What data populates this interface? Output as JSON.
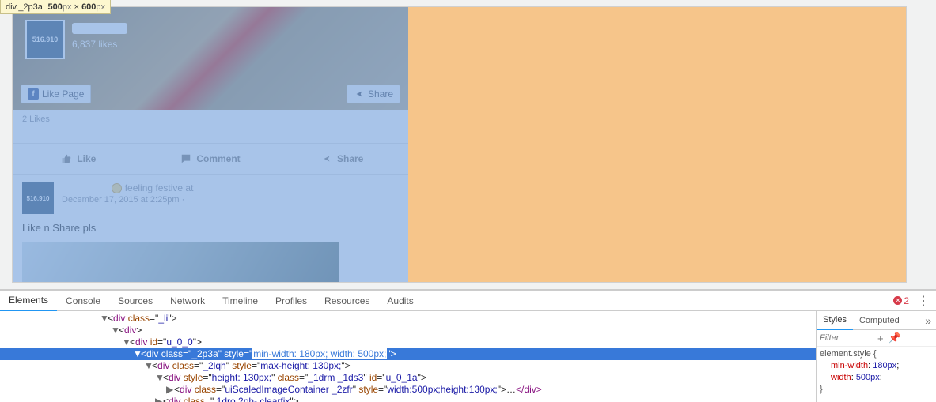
{
  "tooltip": {
    "prefix": "div.",
    "class": "_2p3a",
    "w": "500",
    "h": "600",
    "px": "px",
    "times": " × "
  },
  "page": {
    "avatar_text": "516.910",
    "likes": "6,837 likes",
    "like_page_btn": "Like Page",
    "share_btn": "Share",
    "fb_label": "f",
    "post_likes": "2 Likes",
    "actions": {
      "like": "Like",
      "comment": "Comment",
      "share": "Share"
    },
    "post2": {
      "avatar_text": "516.910",
      "feeling_label": "feeling festive at",
      "timestamp": "December 17, 2015 at 2:25pm",
      "separator": " · ",
      "body": "Like n Share pls"
    }
  },
  "devtools": {
    "tabs": [
      "Elements",
      "Console",
      "Sources",
      "Network",
      "Timeline",
      "Profiles",
      "Resources",
      "Audits"
    ],
    "active_tab": 0,
    "errors": "2",
    "dom": {
      "l1": {
        "tag": "div",
        "class": "_li"
      },
      "l2": {
        "tag": "div"
      },
      "l3": {
        "tag": "div",
        "id": "u_0_0"
      },
      "l4": {
        "tag": "div",
        "class": "_2p3a",
        "style": "min-width: 180px; width: 500px;"
      },
      "l5": {
        "tag": "div",
        "class": "_2lqh",
        "style": "max-height: 130px;"
      },
      "l6": {
        "tag": "div",
        "style": "height: 130px;",
        "class": "_1drm _1ds3",
        "id": "u_0_1a"
      },
      "l7": {
        "tag": "div",
        "class": "uiScaledImageContainer _2zfr",
        "style": "width:500px;height:130px;",
        "ell": "…",
        "close": "</div>"
      },
      "l8": {
        "tag": "div",
        "class": " 1dro  2ph- clearfix"
      }
    },
    "styles": {
      "tabs": [
        "Styles",
        "Computed"
      ],
      "filter_placeholder": "Filter",
      "rule_selector": "element.style {",
      "rule_close": "}",
      "props": [
        {
          "name": "min-width",
          "val": "180px"
        },
        {
          "name": "width",
          "val": "500px"
        }
      ]
    }
  }
}
